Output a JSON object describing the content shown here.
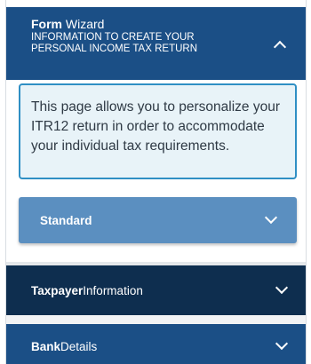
{
  "wizard": {
    "title_bold": "Form",
    "title_rest": " Wizard",
    "subtitle": "INFORMATION TO CREATE YOUR PERSONAL INCOME TAX RETURN",
    "expanded": true
  },
  "info": {
    "text": "This page allows you to personalize your ITR12 return in order to accommodate your individual tax requirements."
  },
  "sections": [
    {
      "bold": "Standard",
      "rest": ""
    },
    {
      "bold": "Taxpayer",
      "rest": " Information"
    },
    {
      "bold": "Bank",
      "rest": " Details"
    }
  ],
  "colors": {
    "header": "#1b4f86",
    "info_border": "#2f8fc4",
    "standard": "#5b8fc0",
    "taxpayer": "#0e2e4f",
    "bank": "#1b4f86"
  },
  "icons": {
    "expanded": "chevron-up-icon",
    "collapsed": "chevron-down-icon"
  }
}
